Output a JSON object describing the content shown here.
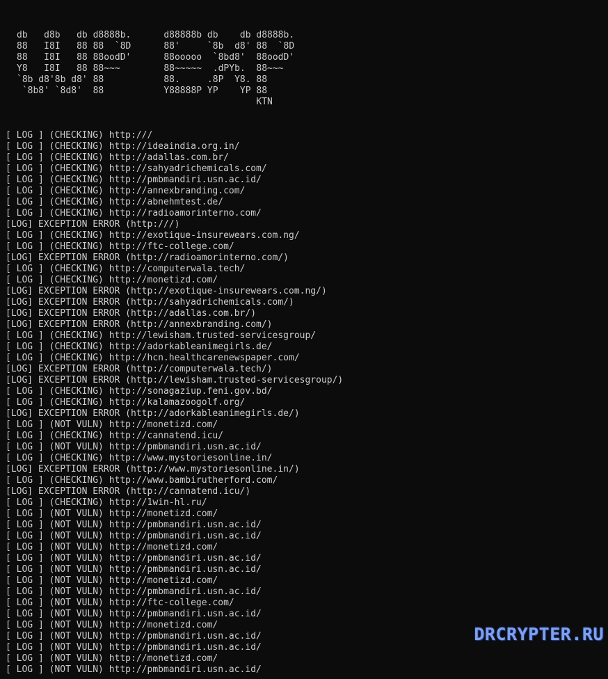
{
  "banner": {
    "lines": [
      "db   d8b   db d8888b.      d88888b db    db d8888b.",
      "88   I8I   88 88  `8D      88'     `8b  d8' 88  `8D",
      "88   I8I   88 88oodD'      88ooooo  `8bd8'  88oodD'",
      "Y8   I8I   88 88~~~        88~~~~~  .dPYb.  88~~~",
      "`8b d8'8b d8' 88           88.     .8P  Y8. 88",
      " `8b8' `8d8'  88           Y88888P YP    YP 88",
      "                                            KTN"
    ]
  },
  "log": {
    "lines": [
      "[ LOG ] (CHECKING) http:///",
      "[ LOG ] (CHECKING) http://ideaindia.org.in/",
      "[ LOG ] (CHECKING) http://adallas.com.br/",
      "[ LOG ] (CHECKING) http://sahyadrichemicals.com/",
      "[ LOG ] (CHECKING) http://pmbmandiri.usn.ac.id/",
      "[ LOG ] (CHECKING) http://annexbranding.com/",
      "[ LOG ] (CHECKING) http://abnehmtest.de/",
      "[ LOG ] (CHECKING) http://radioamorinterno.com/",
      "[LOG] EXCEPTION ERROR (http:///)",
      "[ LOG ] (CHECKING) http://exotique-insurewears.com.ng/",
      "[ LOG ] (CHECKING) http://ftc-college.com/",
      "[LOG] EXCEPTION ERROR (http://radioamorinterno.com/)",
      "[ LOG ] (CHECKING) http://computerwala.tech/",
      "[ LOG ] (CHECKING) http://monetizd.com/",
      "[LOG] EXCEPTION ERROR (http://exotique-insurewears.com.ng/)",
      "[LOG] EXCEPTION ERROR (http://sahyadrichemicals.com/)",
      "[LOG] EXCEPTION ERROR (http://adallas.com.br/)",
      "[LOG] EXCEPTION ERROR (http://annexbranding.com/)",
      "[ LOG ] (CHECKING) http://lewisham.trusted-servicesgroup/",
      "[ LOG ] (CHECKING) http://adorkableanimegirls.de/",
      "[ LOG ] (CHECKING) http://hcn.healthcarenewspaper.com/",
      "[LOG] EXCEPTION ERROR (http://computerwala.tech/)",
      "[LOG] EXCEPTION ERROR (http://lewisham.trusted-servicesgroup/)",
      "[ LOG ] (CHECKING) http://sonagaziup.feni.gov.bd/",
      "[ LOG ] (CHECKING) http://kalamazoogolf.org/",
      "[LOG] EXCEPTION ERROR (http://adorkableanimegirls.de/)",
      "[ LOG ] (NOT VULN) http://monetizd.com/",
      "[ LOG ] (CHECKING) http://cannatend.icu/",
      "[ LOG ] (NOT VULN) http://pmbmandiri.usn.ac.id/",
      "[ LOG ] (CHECKING) http://www.mystoriesonline.in/",
      "[LOG] EXCEPTION ERROR (http://www.mystoriesonline.in/)",
      "[ LOG ] (CHECKING) http://www.bambirutherford.com/",
      "[LOG] EXCEPTION ERROR (http://cannatend.icu/)",
      "[ LOG ] (CHECKING) http://1win-hl.ru/",
      "[ LOG ] (NOT VULN) http://monetizd.com/",
      "[ LOG ] (NOT VULN) http://pmbmandiri.usn.ac.id/",
      "[ LOG ] (NOT VULN) http://pmbmandiri.usn.ac.id/",
      "[ LOG ] (NOT VULN) http://monetizd.com/",
      "[ LOG ] (NOT VULN) http://pmbmandiri.usn.ac.id/",
      "[ LOG ] (NOT VULN) http://pmbmandiri.usn.ac.id/",
      "[ LOG ] (NOT VULN) http://monetizd.com/",
      "[ LOG ] (NOT VULN) http://pmbmandiri.usn.ac.id/",
      "[ LOG ] (NOT VULN) http://ftc-college.com/",
      "[ LOG ] (NOT VULN) http://pmbmandiri.usn.ac.id/",
      "[ LOG ] (NOT VULN) http://monetizd.com/",
      "[ LOG ] (NOT VULN) http://pmbmandiri.usn.ac.id/",
      "[ LOG ] (NOT VULN) http://pmbmandiri.usn.ac.id/",
      "[ LOG ] (NOT VULN) http://monetizd.com/",
      "[ LOG ] (NOT VULN) http://pmbmandiri.usn.ac.id/"
    ]
  },
  "watermark": {
    "text": "DRCRYPTER.RU"
  },
  "colors": {
    "background": "#0c0c0c",
    "text": "#cccccc",
    "watermark": "#7ea0f0"
  }
}
